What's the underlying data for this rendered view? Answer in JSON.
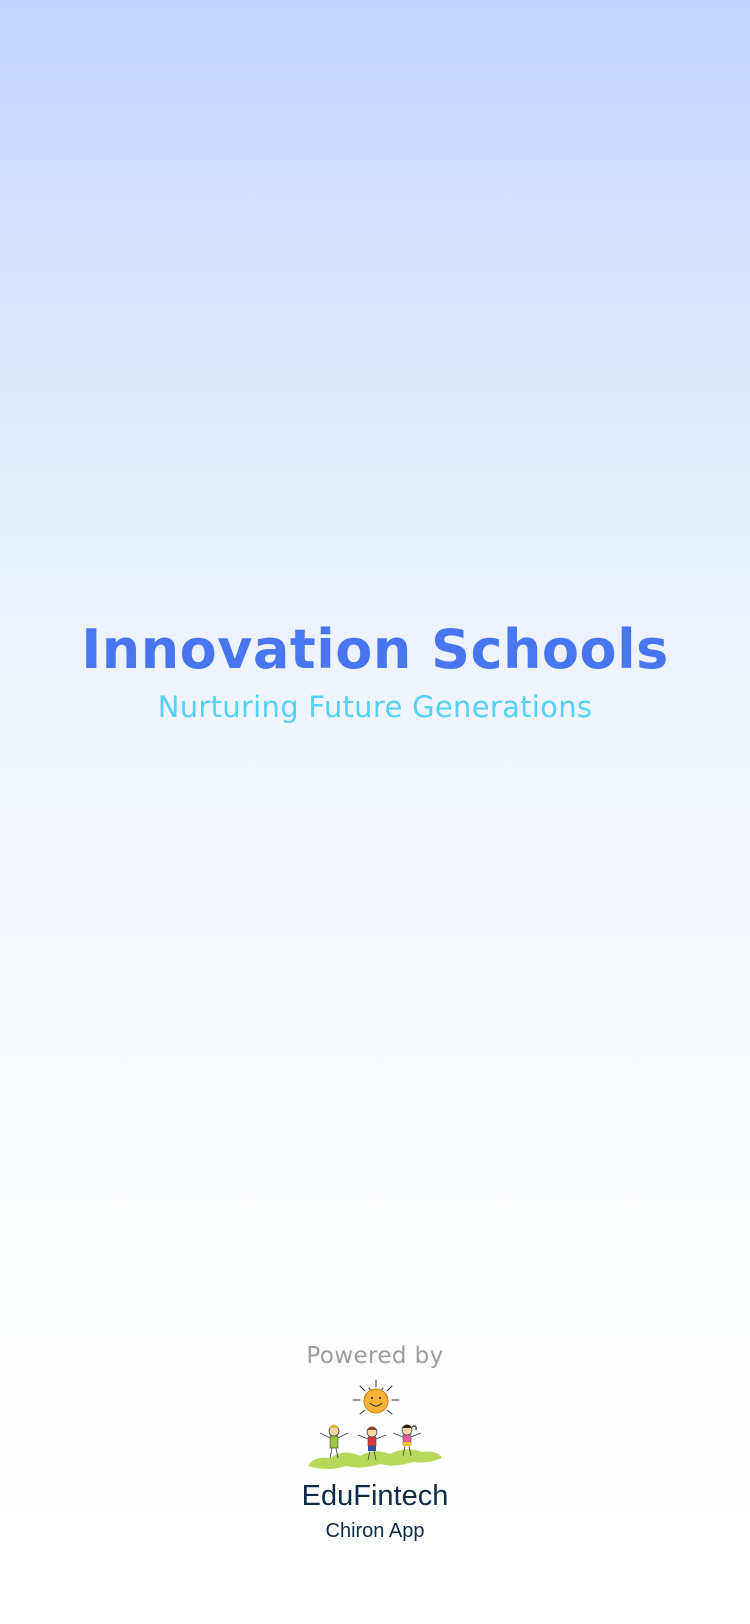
{
  "splash": {
    "title": "Innovation Schools",
    "tagline": "Nurturing Future Generations"
  },
  "footer": {
    "powered_by": "Powered by",
    "logo_icon": "kids-and-sun-logo-icon",
    "company": "EduFintech",
    "product": "Chiron App"
  },
  "colors": {
    "title": "#4876f1",
    "tagline": "#55d2f8",
    "gradient_top": "#c0d5fe",
    "gradient_bottom": "#ffffff"
  }
}
